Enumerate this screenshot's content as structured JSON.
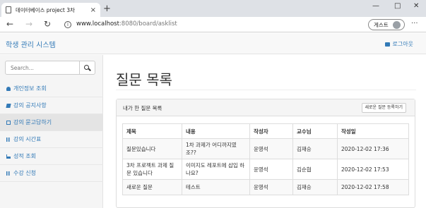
{
  "browser": {
    "tab_title": "데이터베이스 project 3차",
    "tab_close": "×",
    "new_tab": "+",
    "url_host": "www.localhost",
    "url_path": ":8080/board/asklist",
    "guest_label": "게스트",
    "more": "···"
  },
  "app": {
    "brand": "학생 관리 시스템",
    "logout": "로그아웃"
  },
  "sidebar": {
    "search_placeholder": "Search...",
    "items": [
      {
        "label": "개인정보 조회",
        "icon": "user-icon",
        "active": false
      },
      {
        "label": "강의 공지사항",
        "icon": "book-icon",
        "active": false
      },
      {
        "label": "강의 묻고답하기",
        "icon": "edit-icon",
        "active": true
      },
      {
        "label": "강의 시간표",
        "icon": "table-icon",
        "active": false
      },
      {
        "label": "성적 조회",
        "icon": "bar-chart-icon",
        "active": false
      },
      {
        "label": "수강 신청",
        "icon": "table-icon",
        "active": false
      }
    ]
  },
  "main": {
    "page_title": "질문 목록",
    "panel_title": "내가 한 질문 목록",
    "new_button": "새로운 질문 등록하기",
    "table": {
      "headers": [
        "제목",
        "내용",
        "작성자",
        "교수님",
        "작성일"
      ],
      "rows": [
        [
          "질문있습니다",
          "1차 과제가 어디까지였조??",
          "윤영석",
          "김재승",
          "2020-12-02 17:36"
        ],
        [
          "3차 프로젝트 과제 질문 있습니다",
          "이미지도 레포트에 삽입 하나요?",
          "윤영석",
          "김순협",
          "2020-12-02 17:53"
        ],
        [
          "새로운 질문",
          "테스트",
          "윤영석",
          "김재승",
          "2020-12-02 17:58"
        ]
      ]
    }
  },
  "colors": {
    "link": "#337ab7",
    "sidebar_bg": "#f5f5f5",
    "active_item_bg": "#e4e4e4"
  }
}
